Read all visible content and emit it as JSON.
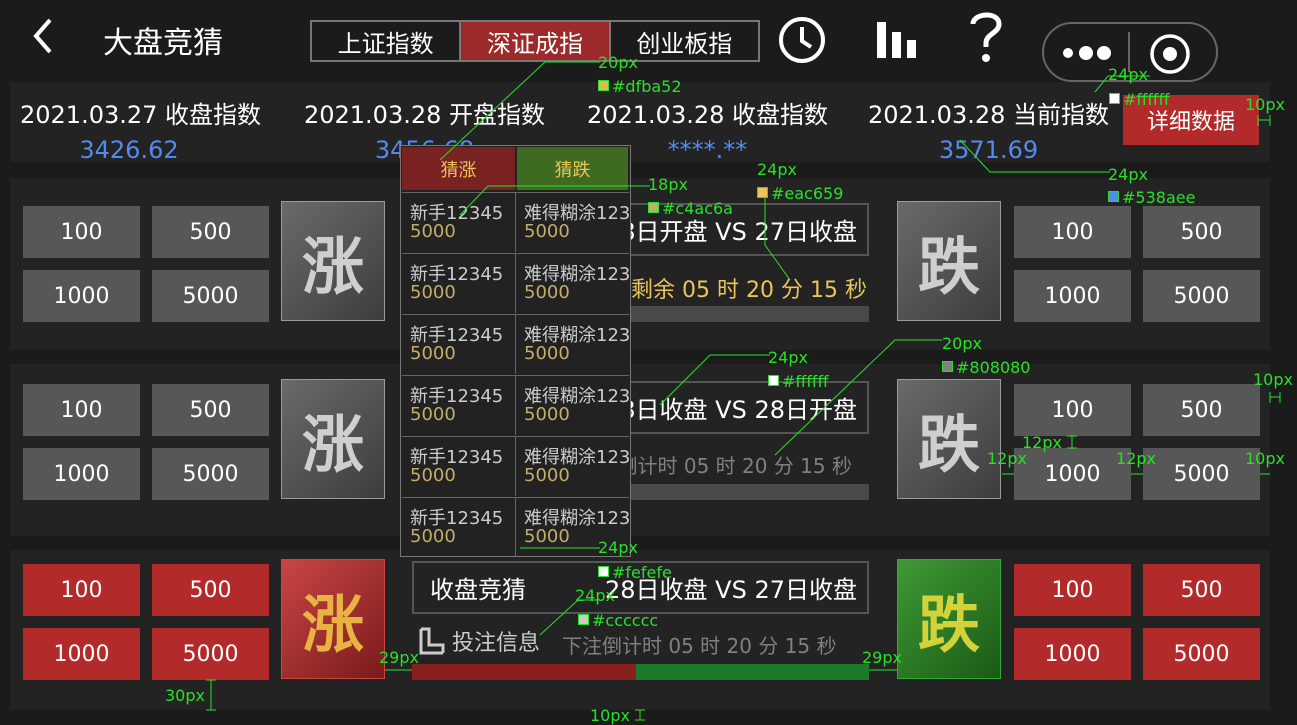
{
  "header": {
    "back_icon": "chevron-left-icon",
    "title": "大盘竞猜",
    "tabs": [
      {
        "label": "上证指数",
        "active": false
      },
      {
        "label": "深证成指",
        "active": true
      },
      {
        "label": "创业板指",
        "active": false
      }
    ],
    "icons": [
      "clock-icon",
      "bar-chart-icon",
      "question-icon",
      "more-icon",
      "target-icon"
    ]
  },
  "info": {
    "items": [
      {
        "label": "2021.03.27 收盘指数",
        "value": "3426.62"
      },
      {
        "label": "2021.03.28 开盘指数",
        "value": "3456.68"
      },
      {
        "label": "2021.03.28 收盘指数",
        "value": "****.**"
      },
      {
        "label": "2021.03.28 当前指数",
        "value": "3571.69"
      }
    ],
    "detail_button": "详细数据"
  },
  "rise_label": "涨",
  "fall_label": "跌",
  "bet_amounts": [
    "100",
    "500",
    "1000",
    "5000"
  ],
  "rounds": [
    {
      "match": "28日开盘 VS 27日收盘",
      "countdown": "剩余 05 时 20 分 15 秒"
    },
    {
      "match": "28日收盘 VS 28日开盘",
      "countdown": "下注倒计时 05 时 20 分 15 秒"
    },
    {
      "title": "收盘竞猜",
      "match": "28日收盘 VS 27日收盘",
      "info_label": "投注信息",
      "countdown": "下注倒计时 05 时 20 分 15 秒"
    }
  ],
  "dropdown": {
    "header_up": "猜涨",
    "header_down": "猜跌",
    "rows": [
      {
        "up_name": "新手12345",
        "up_amount": "5000",
        "down_name": "难得糊涂123",
        "down_amount": "5000"
      },
      {
        "up_name": "新手12345",
        "up_amount": "5000",
        "down_name": "难得糊涂123",
        "down_amount": "5000"
      },
      {
        "up_name": "新手12345",
        "up_amount": "5000",
        "down_name": "难得糊涂123",
        "down_amount": "5000"
      },
      {
        "up_name": "新手12345",
        "up_amount": "5000",
        "down_name": "难得糊涂123",
        "down_amount": "5000"
      },
      {
        "up_name": "新手12345",
        "up_amount": "5000",
        "down_name": "难得糊涂123",
        "down_amount": "5000"
      },
      {
        "up_name": "新手12345",
        "up_amount": "5000",
        "down_name": "难得糊涂123",
        "down_amount": "5000"
      }
    ]
  },
  "progress": {
    "up_fraction": 0.49
  },
  "annotations": [
    "20px",
    "#dfba52",
    "24px",
    "#ffffff",
    "10px",
    "24px",
    "#538aee",
    "18px",
    "#c4ac6a",
    "24px",
    "#eac659",
    "24px",
    "#ffffff",
    "20px",
    "#808080",
    "10px",
    "12px",
    "12px",
    "12px",
    "10px",
    "24px",
    "#fefefe",
    "24px",
    "#cccccc",
    "29px",
    "29px",
    "30px",
    "10px"
  ],
  "colors": {
    "accent_red": "#b32a2a",
    "info_blue": "#538aee",
    "gold": "#eac659",
    "dropdown_amount": "#c4ac6a",
    "green_bar": "#1e7a2a"
  }
}
